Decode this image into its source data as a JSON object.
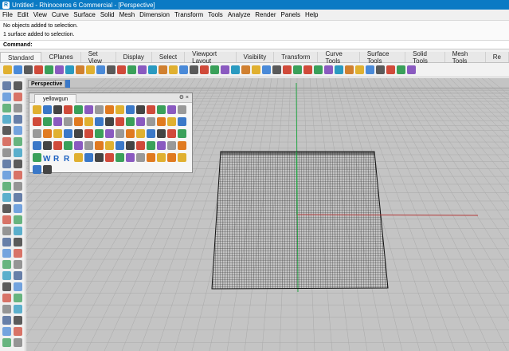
{
  "window": {
    "title": "Untitled - Rhinoceros 6 Commercial - [Perspective]"
  },
  "menu": [
    "File",
    "Edit",
    "View",
    "Curve",
    "Surface",
    "Solid",
    "Mesh",
    "Dimension",
    "Transform",
    "Tools",
    "Analyze",
    "Render",
    "Panels",
    "Help"
  ],
  "history": {
    "line1": "No objects added to selection.",
    "line2": "1 surface added to selection."
  },
  "command": {
    "label": "Command:",
    "value": ""
  },
  "tabs": [
    "Standard",
    "CPlanes",
    "Set View",
    "Display",
    "Select",
    "Viewport Layout",
    "Visibility",
    "Transform",
    "Curve Tools",
    "Surface Tools",
    "Solid Tools",
    "Mesh Tools",
    "Re"
  ],
  "active_tab": "Standard",
  "viewport": {
    "name": "Perspective"
  },
  "panel": {
    "tab": "yellowgun",
    "controls": "⚙ ×",
    "row_labels": [
      "W",
      "R",
      "R"
    ]
  },
  "colors": {
    "titlebar": "#0a7ac4",
    "viewport_bg": "#c4c4c4",
    "x_axis": "#b33a3a",
    "y_axis": "#2aa84a",
    "surface_mesh": "#2b2b2b"
  },
  "icons": {
    "toolbar": [
      "new-icon",
      "open-icon",
      "save-icon",
      "print-icon",
      "import-icon",
      "cut-icon",
      "copy-icon",
      "paste-icon",
      "undo-icon",
      "pan-icon",
      "rotate-icon",
      "zoom-icon",
      "zoom-window-icon",
      "zoom-extents-icon",
      "zoom-selected-icon",
      "rotate-view-icon",
      "grid-icon",
      "layer-icon",
      "properties-icon",
      "lock-icon",
      "bulb-icon",
      "shade-icon",
      "render-icon",
      "material-icon",
      "sun-icon",
      "environment-icon",
      "lights-icon",
      "network-icon",
      "help-icon"
    ]
  }
}
